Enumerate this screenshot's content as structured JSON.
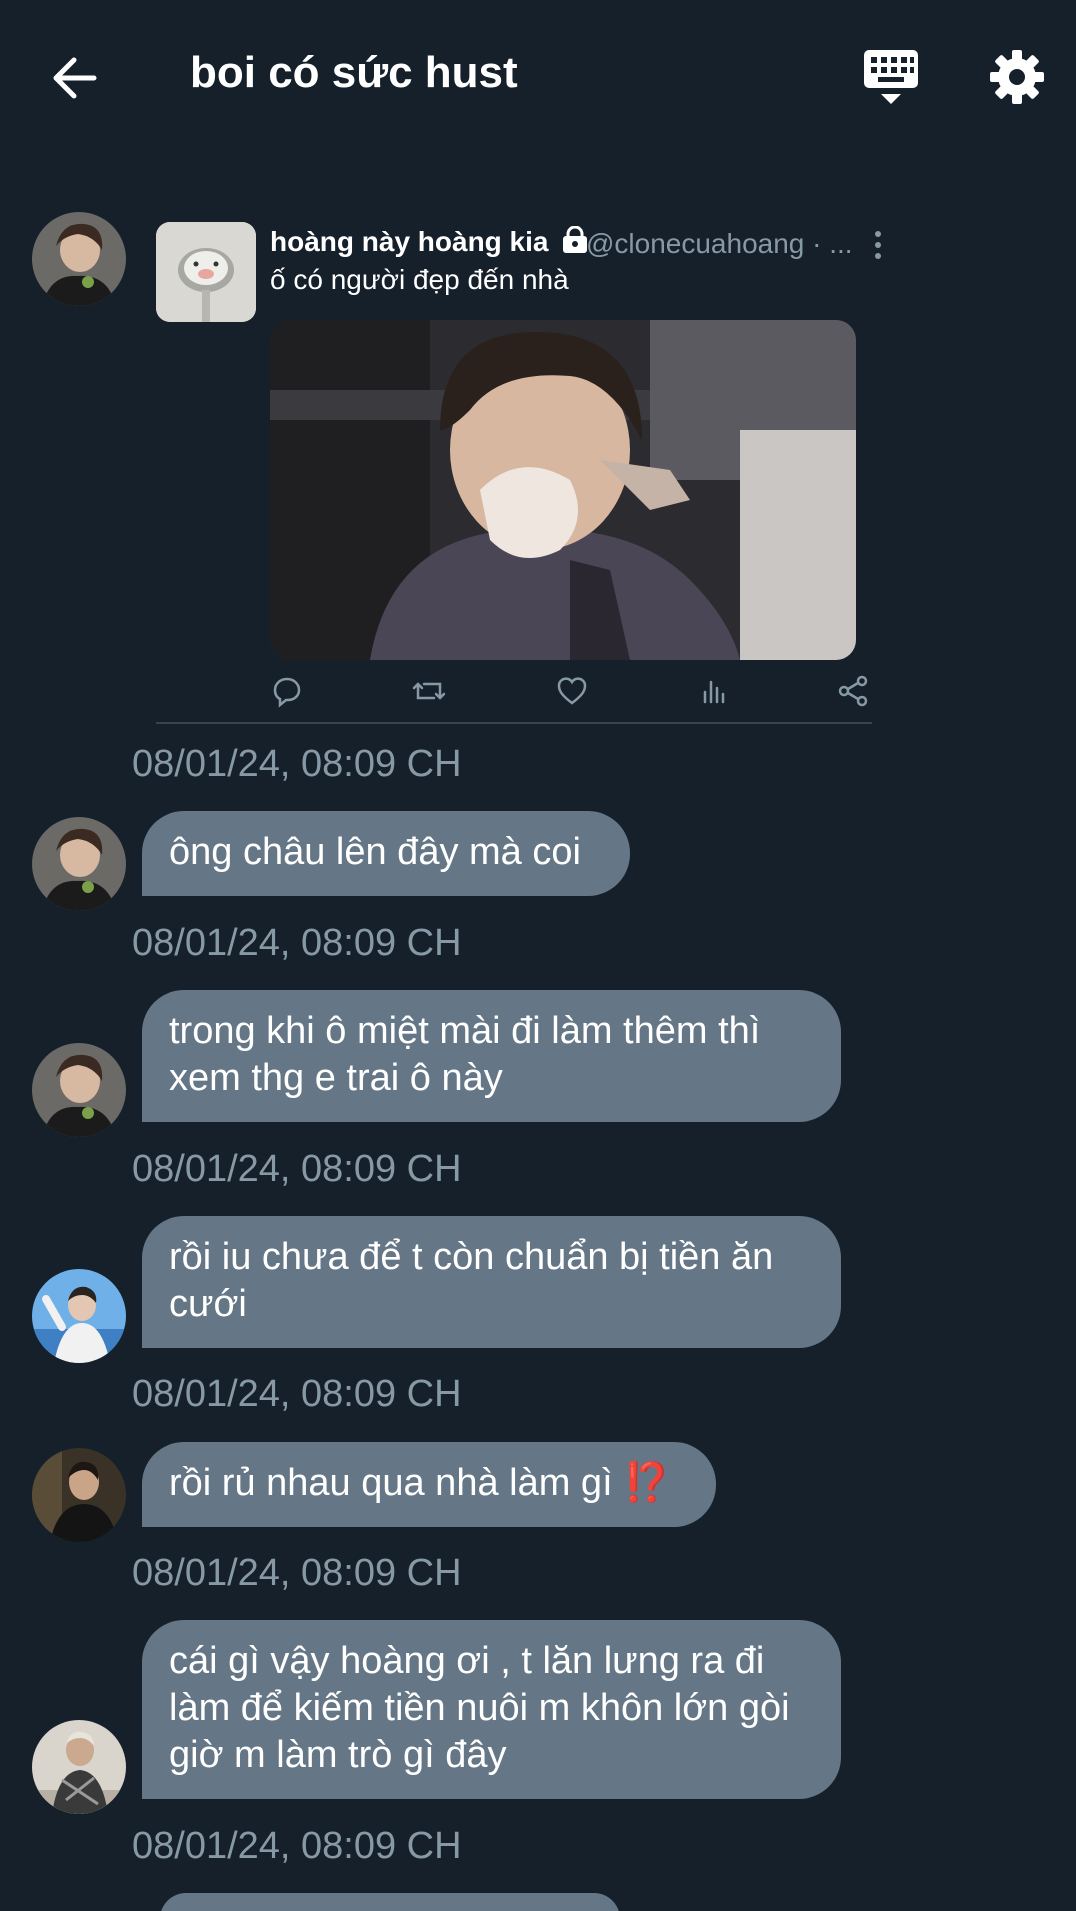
{
  "header": {
    "title": "boi có sức hust"
  },
  "tweet": {
    "author_name": "hoàng này hoàng kia",
    "handle": "@clonecuahoang · ...",
    "text": "ố có người đẹp đến nhà"
  },
  "messages": [
    {
      "text": "ông châu lên đây mà coi",
      "timestamp": "08/01/24, 08:09 CH"
    },
    {
      "text": "trong khi ô miệt mài đi làm thêm thì xem thg e trai ô này",
      "timestamp": "08/01/24, 08:09 CH"
    },
    {
      "text": "rồi iu chưa để t còn chuẩn bị tiền ăn cưới",
      "timestamp": "08/01/24, 08:09 CH"
    },
    {
      "text": "rồi rủ nhau qua nhà làm gì ⁉️",
      "timestamp": "08/01/24, 08:09 CH"
    },
    {
      "text": "cái gì vậy hoàng ơi , t lăn lưng ra đi làm để kiếm tiền nuôi m khôn lớn gòi giờ m làm trò gì đây",
      "timestamp": "08/01/24, 08:09 CH"
    }
  ],
  "tweet_timestamp": "08/01/24, 08:09 CH",
  "colors": {
    "background": "#15202b",
    "bubble": "#657786",
    "muted_text": "#8899a6"
  }
}
